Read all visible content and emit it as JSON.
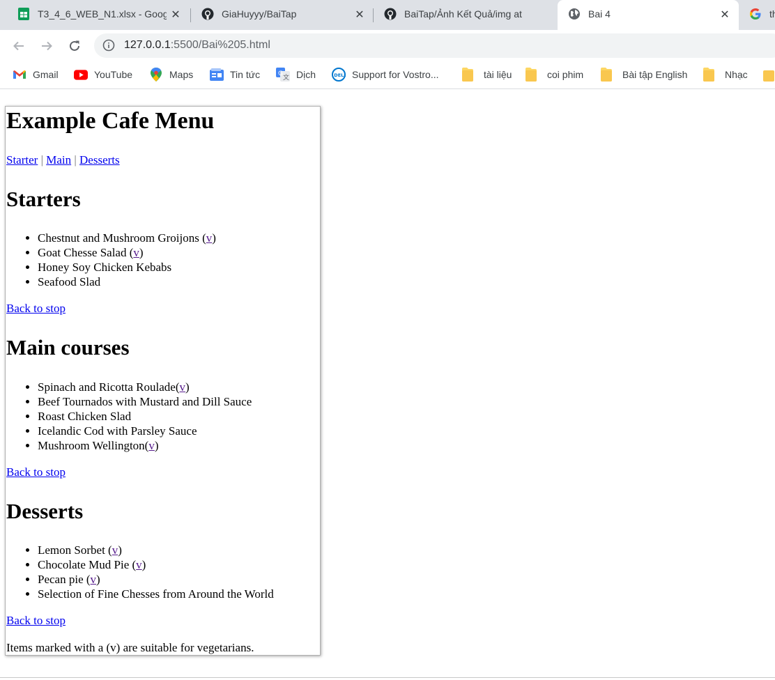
{
  "browser": {
    "tabs": [
      {
        "title": "T3_4_6_WEB_N1.xlsx - Goog",
        "icon": "sheets-icon",
        "active": false
      },
      {
        "title": "GiaHuyyy/BaiTap",
        "icon": "github-icon",
        "active": false
      },
      {
        "title": "BaiTap/Ảnh Kết Quả/img at",
        "icon": "github-icon",
        "active": false
      },
      {
        "title": "Bai 4",
        "icon": "globe-icon",
        "active": true
      },
      {
        "title": "th",
        "icon": "google-icon",
        "active": false
      }
    ],
    "url_host": "127.0.0.1",
    "url_rest": ":5500/Bai%205.html",
    "bookmarks": [
      {
        "label": "Gmail",
        "icon": "gmail-icon"
      },
      {
        "label": "YouTube",
        "icon": "youtube-icon"
      },
      {
        "label": "Maps",
        "icon": "maps-icon"
      },
      {
        "label": "Tin tức",
        "icon": "news-icon"
      },
      {
        "label": "Dịch",
        "icon": "translate-icon"
      },
      {
        "label": "Support for Vostro...",
        "icon": "dell-icon"
      },
      {
        "label": "tài liệu",
        "icon": "folder-icon"
      },
      {
        "label": "coi phim",
        "icon": "folder-icon"
      },
      {
        "label": "Bài tập English",
        "icon": "folder-icon"
      },
      {
        "label": "Nhạc",
        "icon": "folder-icon"
      }
    ],
    "colors": {
      "tabstrip": "#dee1e6",
      "link": "#0000ee",
      "visited_link": "#551a8b"
    }
  },
  "page": {
    "title": "Example Cafe Menu",
    "nav": {
      "starter": "Starter",
      "sep": "|",
      "main": "Main",
      "desserts": "Desserts"
    },
    "back_link": "Back to stop",
    "v_marker": "v",
    "starters": {
      "heading": "Starters",
      "items": [
        {
          "pre": "Chestnut and Mushroom Groijons (",
          "v": "v",
          "post": ")"
        },
        {
          "pre": "Goat Chesse Salad (",
          "v": "v",
          "post": ")"
        },
        {
          "pre": "Honey Soy Chicken Kebabs",
          "v": "",
          "post": ""
        },
        {
          "pre": "Seafood Slad",
          "v": "",
          "post": ""
        }
      ]
    },
    "main": {
      "heading": "Main courses",
      "items": [
        {
          "pre": "Spinach and Ricotta Roulade(",
          "v": "v",
          "post": ")"
        },
        {
          "pre": "Beef Tournados with Mustard and Dill Sauce",
          "v": "",
          "post": ""
        },
        {
          "pre": "Roast Chicken Slad",
          "v": "",
          "post": ""
        },
        {
          "pre": "Icelandic Cod with Parsley Sauce",
          "v": "",
          "post": ""
        },
        {
          "pre": "Mushroom Wellington(",
          "v": "v",
          "post": ")"
        }
      ]
    },
    "desserts": {
      "heading": "Desserts",
      "items": [
        {
          "pre": "Lemon Sorbet (",
          "v": "v",
          "post": ")"
        },
        {
          "pre": "Chocolate Mud Pie (",
          "v": "v",
          "post": ")"
        },
        {
          "pre": "Pecan pie (",
          "v": "v",
          "post": ")"
        },
        {
          "pre": "Selection of Fine Chesses from Around the World",
          "v": "",
          "post": ""
        }
      ]
    },
    "footnote": "Items marked with a (v) are suitable for vegetarians."
  }
}
